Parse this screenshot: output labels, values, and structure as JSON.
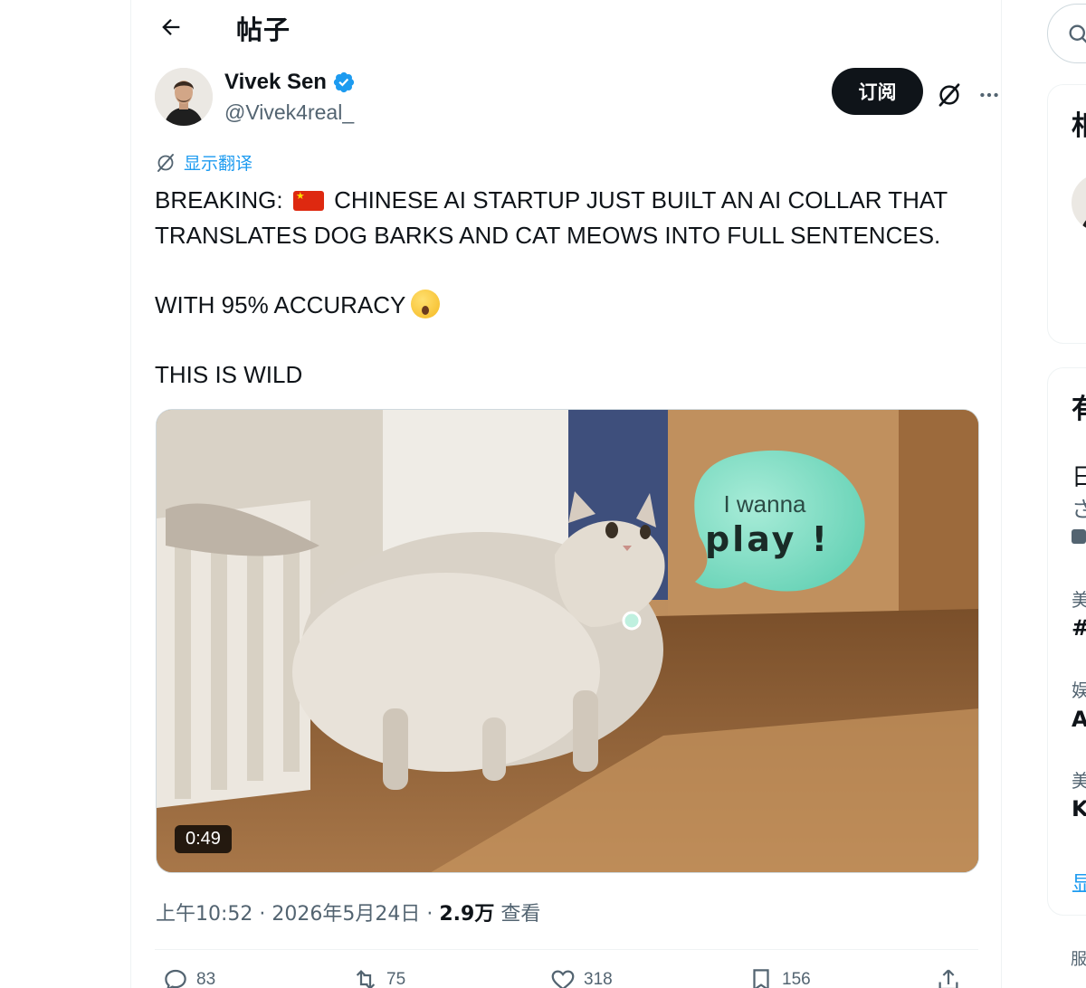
{
  "header": {
    "title": "帖子"
  },
  "author": {
    "name": "Vivek Sen",
    "handle": "@Vivek4real_",
    "verified": true,
    "subscribe_label": "订阅"
  },
  "translate_label": "显示翻译",
  "tweet": {
    "line1": "BREAKING:",
    "line1_rest": "CHINESE AI STARTUP JUST BUILT AN AI COLLAR THAT",
    "line2": "TRANSLATES DOG BARKS AND CAT MEOWS INTO FULL SENTENCES.",
    "line3": "WITH 95% ACCURACY",
    "line4": "THIS IS WILD"
  },
  "media": {
    "duration": "0:49",
    "bubble_line1": "I wanna",
    "bubble_line2": "play !"
  },
  "meta": {
    "time": "上午10:52",
    "sep1": " · ",
    "date": "2026年5月24日",
    "sep2": " · ",
    "views": "2.9万",
    "views_label": " 查看"
  },
  "actions": {
    "replies": "83",
    "reposts": "75",
    "likes": "318",
    "bookmarks": "156"
  },
  "right_sidebar": {
    "card1_heading": "相",
    "card2_heading": "有",
    "item1_line1": "日",
    "item1_line2": "さ",
    "item2_line1": "美",
    "item2_line2": "#",
    "item3_line1": "娱",
    "item3_line2": "A",
    "item4_line1": "美",
    "item4_line2": "K",
    "show_more": "显",
    "footer": "服"
  },
  "colors": {
    "accent": "#1d9bf0",
    "text": "#0f1419",
    "muted": "#536471",
    "verified": "#1d9bf0"
  }
}
